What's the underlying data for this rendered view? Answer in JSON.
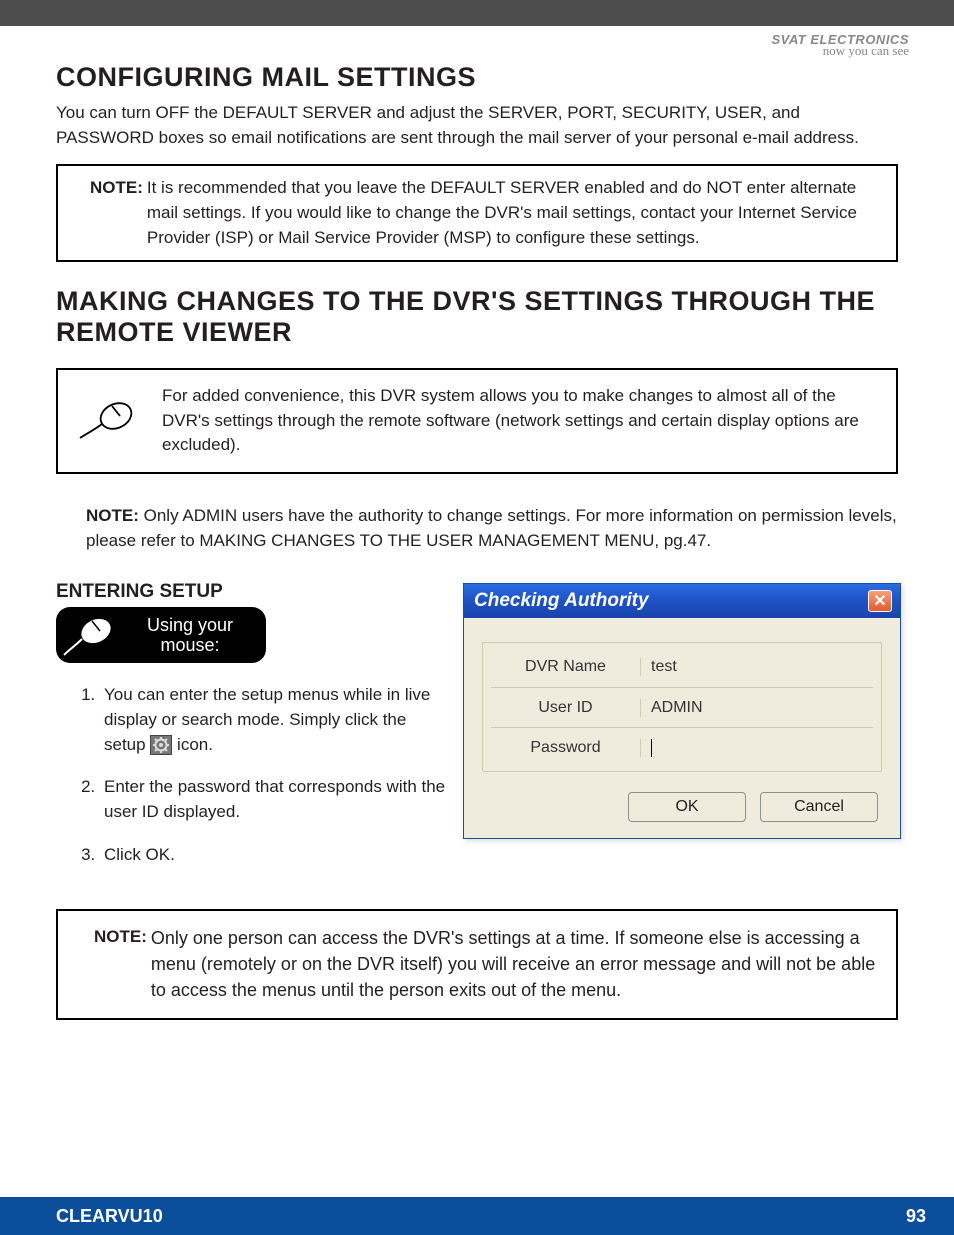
{
  "brand": {
    "name": "SVAT ELECTRONICS",
    "tagline": "now you can see"
  },
  "section1": {
    "title": "CONFIGURING MAIL SETTINGS",
    "intro": "You can turn OFF the DEFAULT SERVER and adjust the SERVER, PORT, SECURITY, USER, and PASSWORD boxes so email notifications are sent through the mail server of your personal e-mail address.",
    "note_label": "NOTE:",
    "note_text": "It is recommended that you leave the DEFAULT SERVER enabled and do NOT enter alternate mail settings.  If you would like to change the DVR's mail settings, contact your Internet Service Provider (ISP) or Mail Service Provider (MSP) to configure these settings."
  },
  "section2": {
    "title": "MAKING CHANGES TO THE DVR'S SETTINGS THROUGH THE REMOTE VIEWER",
    "convenience": "For added convenience, this DVR system allows you to make changes to almost all of the DVR's settings through the remote software (network settings and certain display options are excluded).",
    "note_label": "NOTE:",
    "note_text": "Only ADMIN users have the authority to change settings.  For more information on permission levels, please refer to MAKING CHANGES TO THE USER MANAGEMENT MENU, pg.47."
  },
  "entering": {
    "title": "ENTERING SETUP",
    "pill_line1": "Using your",
    "pill_line2": "mouse:",
    "step1_a": "You can enter the setup menus while in live display or search mode.  Simply click the setup ",
    "step1_b": " icon.",
    "step2": "Enter the password that corresponds with the user ID displayed.",
    "step3": "Click OK."
  },
  "dialog": {
    "title": "Checking Authority",
    "labels": {
      "dvr": "DVR Name",
      "user": "User ID",
      "pwd": "Password"
    },
    "values": {
      "dvr": "test",
      "user": "ADMIN",
      "pwd": ""
    },
    "ok": "OK",
    "cancel": "Cancel"
  },
  "bottom_note": {
    "label": "NOTE:",
    "text": "Only one person can access the DVR's settings at a time. If someone else is accessing a menu (remotely or on the DVR itself) you will receive an error message and will not be able to access the menus until the person exits out of the menu."
  },
  "footer": {
    "product": "CLEARVU10",
    "page": "93"
  }
}
